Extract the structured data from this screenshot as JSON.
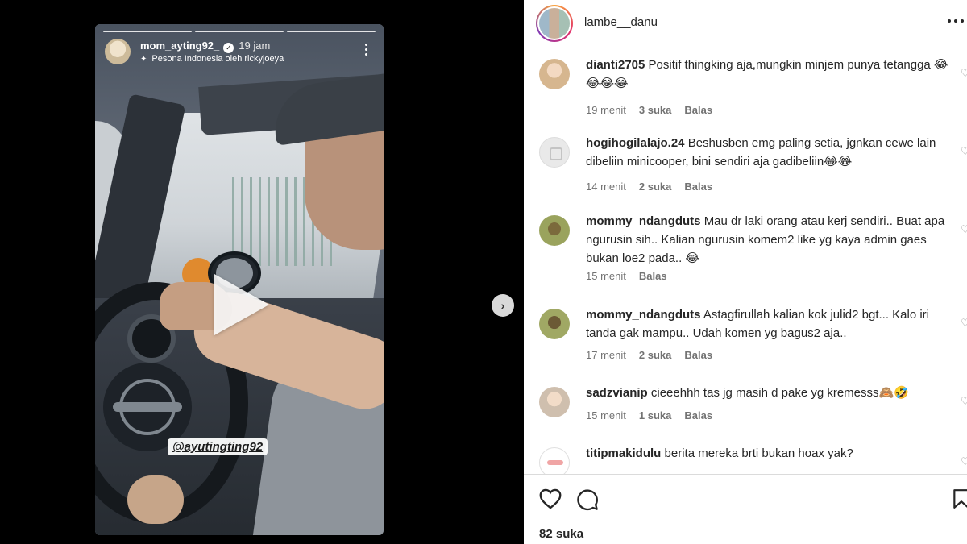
{
  "story": {
    "username": "mom_ayting92_",
    "time": "19 jam",
    "music": "Pesona Indonesia oleh rickyjoeya",
    "mention": "@ayutingting92"
  },
  "post": {
    "username": "lambe__danu",
    "likes": "82 suka"
  },
  "comments": [
    {
      "user": "dianti2705",
      "text": "Positif thingking aja,mungkin minjem punya tetangga 😂😂😂😂",
      "time": "19 menit",
      "likes": "3 suka",
      "reply": "Balas"
    },
    {
      "user": "hogihogilalajo.24",
      "text": "Beshusben emg paling setia, jgnkan cewe lain dibeliin minicooper, bini sendiri aja gadibeliin😂😂",
      "time": "14 menit",
      "likes": "2 suka",
      "reply": "Balas"
    },
    {
      "user": "mommy_ndangduts",
      "text": "Mau dr laki orang atau kerj sendiri.. Buat apa ngurusin sih.. Kalian ngurusin komem2 like yg kaya admin gaes bukan loe2 pada.. 😂",
      "time": "15 menit",
      "likes": "",
      "reply": "Balas"
    },
    {
      "user": "mommy_ndangduts",
      "text": "Astagfirullah kalian kok julid2 bgt... Kalo iri tanda gak mampu.. Udah komen yg bagus2 aja..",
      "time": "17 menit",
      "likes": "2 suka",
      "reply": "Balas"
    },
    {
      "user": "sadzvianip",
      "text": "cieeehhh tas jg masih d pake yg kremesss🙈🤣",
      "time": "15 menit",
      "likes": "1 suka",
      "reply": "Balas"
    },
    {
      "user": "titipmakidulu",
      "text": "berita mereka brti bukan hoax yak?",
      "time": "",
      "likes": "",
      "reply": ""
    }
  ],
  "icons": {
    "next": "chevron-right-icon",
    "verified": "verified-badge-icon",
    "music": "sparkle-music-icon",
    "like": "heart-icon",
    "comment": "comment-bubble-icon",
    "save": "bookmark-icon"
  },
  "colors": {
    "panel_bg": "#ffffff",
    "text": "#262626",
    "muted": "#737373",
    "divider": "#dbdbdb"
  }
}
